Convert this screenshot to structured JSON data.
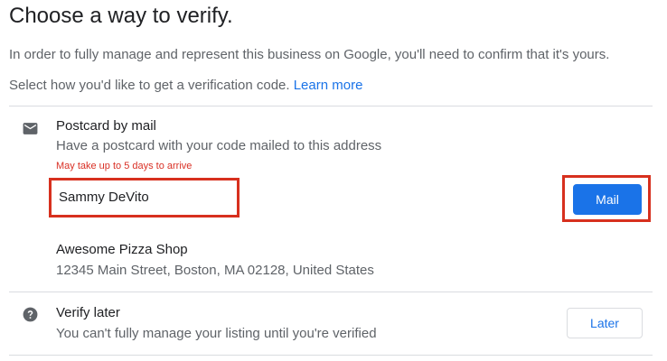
{
  "header": {
    "title": "Choose a way to verify."
  },
  "intro": {
    "line1": "In order to fully manage and represent this business on Google, you'll need to confirm that it's yours.",
    "line2_prefix": "Select how you'd like to get a verification code. ",
    "learn_more_link": "Learn more"
  },
  "options": {
    "postcard": {
      "icon": "mail-icon",
      "title": "Postcard by mail",
      "description": "Have a postcard with your code mailed to this address",
      "warning": "May take up to 5 days to arrive",
      "contact_name": "Sammy DeVito",
      "button_label": "Mail",
      "business_name": "Awesome Pizza Shop",
      "business_address": "12345 Main Street, Boston, MA 02128, United States"
    },
    "later": {
      "icon": "help-icon",
      "title": "Verify later",
      "description": "You can't fully manage your listing until you're verified",
      "button_label": "Later"
    }
  },
  "colors": {
    "primary_blue": "#1a73e8",
    "warning_red": "#d93025",
    "highlight_red": "#d7301e",
    "icon_grey": "#5f6368"
  }
}
